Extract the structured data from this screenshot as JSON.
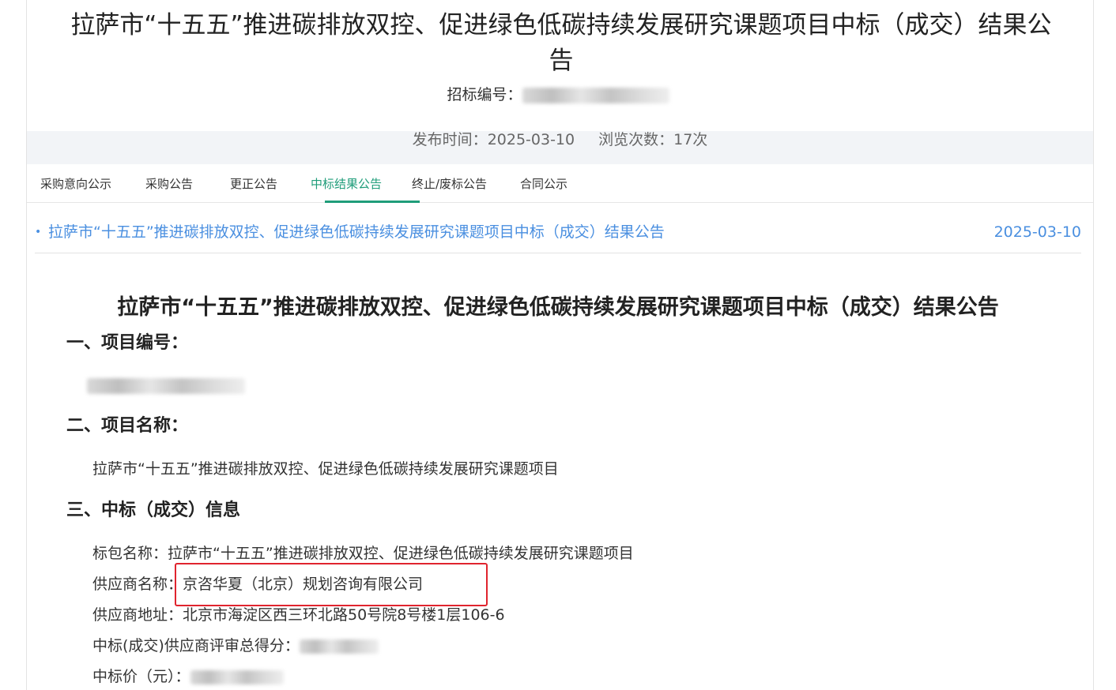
{
  "header": {
    "title": "拉萨市“十五五”推进碳排放双控、促进绿色低碳持续发展研究课题项目中标（成交）结果公告",
    "bid_no_label": "招标编号："
  },
  "meta": {
    "publish_label": "发布时间：",
    "publish_date": "2025-03-10",
    "views_label": "浏览次数：",
    "views": "17次"
  },
  "tabs": [
    {
      "label": "采购意向公示"
    },
    {
      "label": "采购公告"
    },
    {
      "label": "更正公告"
    },
    {
      "label": "中标结果公告"
    },
    {
      "label": "终止/废标公告"
    },
    {
      "label": "合同公示"
    }
  ],
  "list": {
    "link": "拉萨市“十五五”推进碳排放双控、促进绿色低碳持续发展研究课题项目中标（成交）结果公告",
    "date": "2025-03-10"
  },
  "doc": {
    "title": "拉萨市“十五五”推进碳排放双控、促进绿色低碳持续发展研究课题项目中标（成交）结果公告",
    "sec1": "一、项目编号：",
    "sec2": "二、项目名称：",
    "project_name": "拉萨市“十五五”推进碳排放双控、促进绿色低碳持续发展研究课题项目",
    "sec3": "三、中标（成交）信息",
    "package_label": "标包名称：",
    "package_value": "拉萨市“十五五”推进碳排放双控、促进绿色低碳持续发展研究课题项目",
    "supplier_label": "供应商名称：",
    "supplier_value": "京咨华夏（北京）规划咨询有限公司",
    "address_label": "供应商地址：",
    "address_value": "北京市海淀区西三环北路50号院8号楼1层106-6",
    "score_label": "中标(成交)供应商评审总得分：",
    "price_label": "中标价（元）："
  },
  "colors": {
    "accent": "#1f9d7a",
    "link": "#4a8fe0",
    "highlight": "#e0242e"
  }
}
